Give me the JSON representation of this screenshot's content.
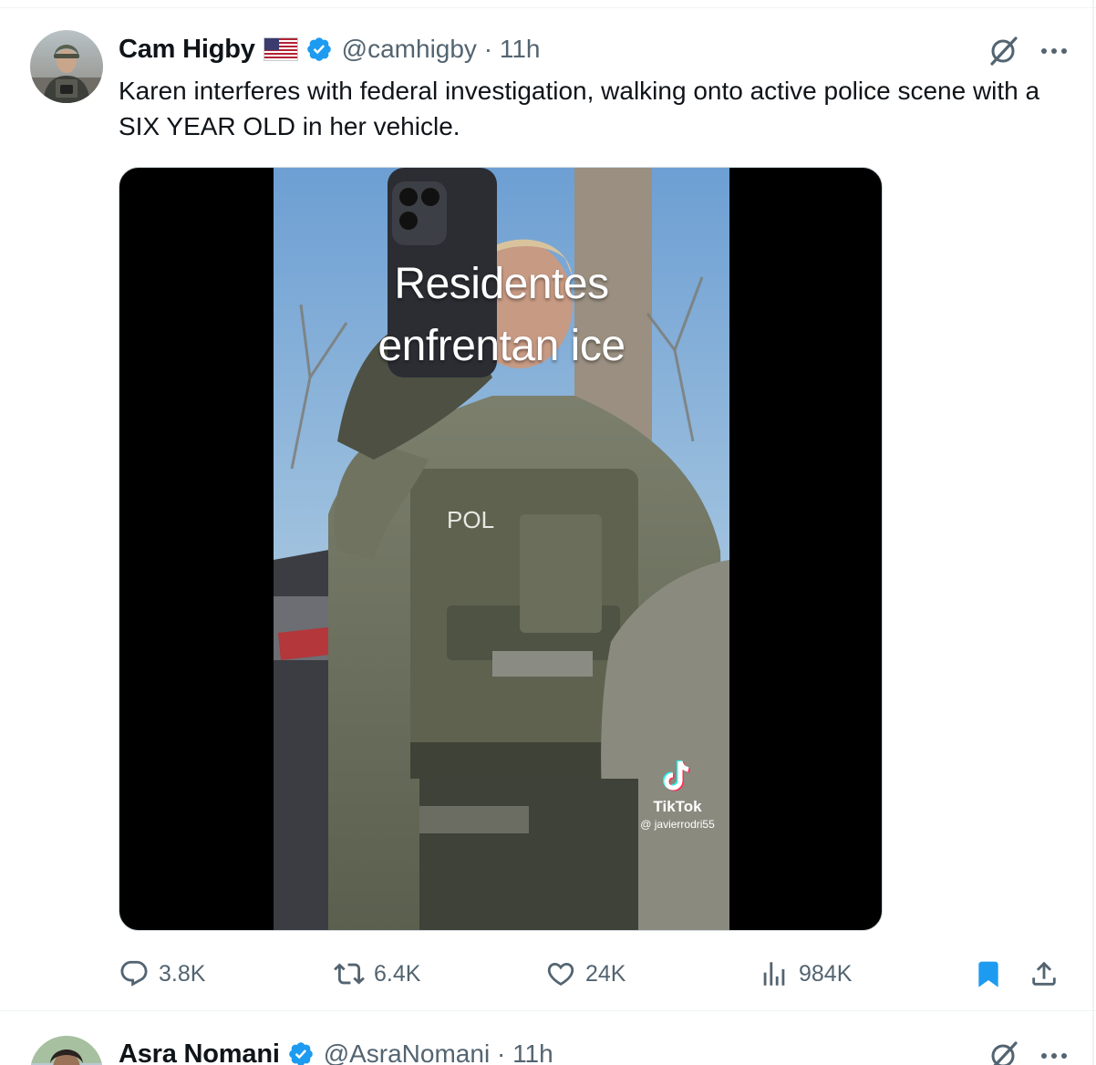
{
  "tweets": [
    {
      "author": "Cam Higby",
      "handle": "@camhigby",
      "time": "11h",
      "text": "Karen interferes with federal investigation, walking onto active police scene with a SIX YEAR OLD in her vehicle.",
      "media": {
        "caption_line1": "Residentes",
        "caption_line2": "enfrentan ice",
        "vest_text": "POL",
        "watermark_app": "TikTok",
        "watermark_user": "@ javierrodri55"
      },
      "stats": {
        "replies": "3.8K",
        "reposts": "6.4K",
        "likes": "24K",
        "views": "984K"
      },
      "icons": {
        "flag": "us-flag-icon",
        "verified": "verified-badge-icon",
        "grok": "grok-icon",
        "more": "more-icon",
        "reply": "reply-icon",
        "repost": "repost-icon",
        "like": "like-icon",
        "views": "views-icon",
        "bookmark": "bookmark-icon",
        "share": "share-icon"
      }
    },
    {
      "author": "Asra Nomani",
      "handle": "@AsraNomani",
      "time": "11h"
    }
  ],
  "colors": {
    "verified": "#1d9bf0",
    "bookmark": "#1d9bf0",
    "secondary_text": "#536471",
    "primary_text": "#0f1419"
  }
}
